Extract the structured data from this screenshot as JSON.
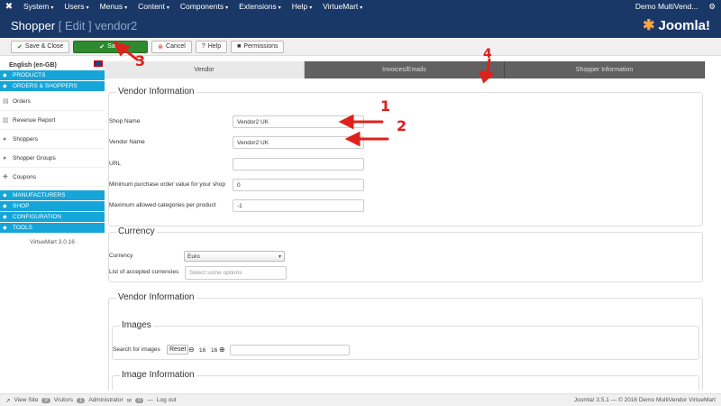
{
  "topbar": {
    "menus": [
      "System",
      "Users",
      "Menus",
      "Content",
      "Components",
      "Extensions",
      "Help",
      "VirtueMart"
    ],
    "site_name": "Demo MultiVend...",
    "gear": "⚙"
  },
  "header": {
    "title_main": "Shopper",
    "title_action": "[ Edit ]",
    "title_item": "vendor2",
    "brand": "Joomla!"
  },
  "toolbar": {
    "save_close": "Save & Close",
    "save": "Save",
    "cancel": "Cancel",
    "help": "Help",
    "permissions": "Permissions"
  },
  "sidebar": {
    "language": "English (en-GB)",
    "sections": {
      "products": "PRODUCTS",
      "orders_shoppers": "ORDERS & SHOPPERS",
      "manufacturers": "MANUFACTURERS",
      "shop": "SHOP",
      "configuration": "CONFIGURATION",
      "tools": "TOOLS"
    },
    "items": [
      "Orders",
      "Revenue Report",
      "Shoppers",
      "Shopper Groups",
      "Coupons"
    ],
    "version": "VirtueMart 3.0.16"
  },
  "tabs": [
    "Vendor",
    "Invoices/Emails",
    "Shopper Information"
  ],
  "vendor_info": {
    "legend": "Vendor Information",
    "shop_name_label": "Shop Name",
    "shop_name_value": "Vendor2 UK",
    "vendor_name_label": "Vendor Name",
    "vendor_name_value": "Vendor2 UK",
    "url_label": "URL",
    "url_value": "",
    "min_order_label": "Minimum purchase order value for your shop",
    "min_order_value": "0",
    "max_cat_label": "Maximum allowed categories per product",
    "max_cat_value": "-1"
  },
  "currency": {
    "legend": "Currency",
    "currency_label": "Currency",
    "currency_value": "Euro",
    "accepted_label": "List of accepted currencies",
    "accepted_placeholder": "Select some options"
  },
  "vendor_info2": {
    "legend": "Vendor Information"
  },
  "images": {
    "legend": "Images",
    "search_label": "Search for images",
    "reset": "Reset",
    "count_a": "16",
    "count_b": "16"
  },
  "image_info": {
    "legend": "Image Information"
  },
  "annotations": [
    "1",
    "2",
    "3",
    "4"
  ],
  "footer": {
    "view_site": "View Site",
    "visitors_count": "0",
    "visitors": "Visitors",
    "admin_count": "1",
    "administrator": "Administrator",
    "messages_count": "0",
    "logout": "Log out",
    "copyright": "Joomla! 3.5.1  —  © 2016 Demo MultiVendor VirtueMart"
  },
  "colors": {
    "header_bg": "#1a3867",
    "save_green": "#2f8a2f",
    "sidebar_section": "#15a5d8",
    "annotation_red": "#e0201b"
  }
}
